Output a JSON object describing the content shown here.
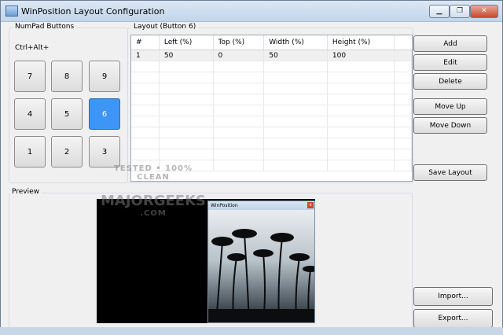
{
  "window": {
    "title": "WinPosition Layout Configuration",
    "controls": {
      "minimize": "▁",
      "maximize": "❐",
      "close": "✕"
    }
  },
  "numpad": {
    "group_label": "NumPad Buttons",
    "modifier": "Ctrl+Alt+",
    "keys": [
      "7",
      "8",
      "9",
      "4",
      "5",
      "6",
      "1",
      "2",
      "3"
    ],
    "selected": "6"
  },
  "layout": {
    "group_label": "Layout (Button 6)",
    "columns": [
      "#",
      "Left (%)",
      "Top (%)",
      "Width (%)",
      "Height (%)"
    ],
    "rows": [
      {
        "n": "1",
        "left": "50",
        "top": "0",
        "width": "50",
        "height": "100"
      }
    ]
  },
  "buttons": {
    "add": "Add",
    "edit": "Edit",
    "delete": "Delete",
    "move_up": "Move Up",
    "move_down": "Move Down",
    "save_layout": "Save Layout",
    "import": "Import...",
    "export": "Export..."
  },
  "preview": {
    "group_label": "Preview",
    "mini_window_title": "WinPosition",
    "mini_close": "x"
  },
  "watermark": {
    "line1": "TESTED • 100% CLEAN",
    "line2": "MAJORGEEKS",
    "line3": ".COM"
  },
  "colors": {
    "selected_key": "#3d95f5",
    "title_bar": "#c2d5ea",
    "close_button": "#c7482e"
  }
}
